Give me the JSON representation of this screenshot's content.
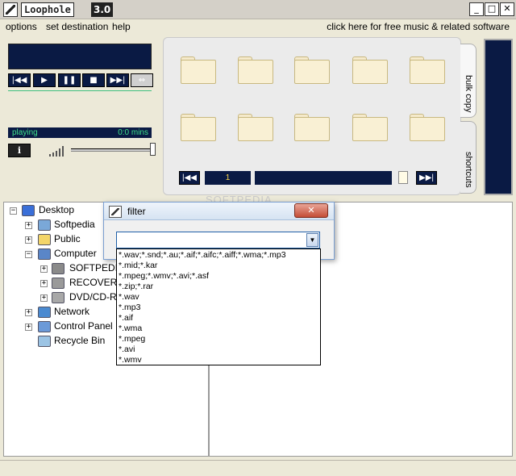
{
  "window": {
    "app_title": "Loophole",
    "app_version": "3.0",
    "minimize_glyph": "_",
    "maximize_glyph": "□",
    "close_glyph": "✕"
  },
  "menu": {
    "items": [
      "options",
      "set destination",
      "help"
    ],
    "promo_link": "click here for free music & related software"
  },
  "player": {
    "transport": {
      "first": "|◀◀",
      "play": "▶",
      "pause": "❚❚",
      "stop": "■",
      "last": "▶▶|",
      "swap": "⇔"
    },
    "status": "playing",
    "time": "0:0 mins",
    "info_label": "i",
    "volume_level": 0.95
  },
  "grid": {
    "folders": [
      {
        "row": 1,
        "col": 1
      },
      {
        "row": 1,
        "col": 2
      },
      {
        "row": 1,
        "col": 3
      },
      {
        "row": 1,
        "col": 4
      },
      {
        "row": 1,
        "col": 5
      },
      {
        "row": 2,
        "col": 1
      },
      {
        "row": 2,
        "col": 2
      },
      {
        "row": 2,
        "col": 3
      },
      {
        "row": 2,
        "col": 4
      },
      {
        "row": 2,
        "col": 5
      }
    ],
    "nav_first": "|◀◀",
    "page": "1",
    "nav_last": "▶▶|"
  },
  "tabs": {
    "bulk_copy": "bulk copy",
    "shortcuts": "shortcuts"
  },
  "tree": {
    "items": [
      {
        "label": "Desktop",
        "icon": "desktop-icon",
        "expander": "−"
      },
      {
        "label": "Softpedia",
        "icon": "user-folder-icon",
        "expander": "+"
      },
      {
        "label": "Public",
        "icon": "folder-icon",
        "expander": "+"
      },
      {
        "label": "Computer",
        "icon": "computer-icon",
        "expander": "−"
      },
      {
        "label": "SOFTPEDIA",
        "icon": "windows-drive-icon",
        "expander": "+"
      },
      {
        "label": "RECOVERY",
        "icon": "drive-icon",
        "expander": "+"
      },
      {
        "label": "DVD/CD-R",
        "icon": "dvd-drive-icon",
        "expander": "+"
      },
      {
        "label": "Network",
        "icon": "network-icon",
        "expander": "+"
      },
      {
        "label": "Control Panel",
        "icon": "control-panel-icon",
        "expander": "+"
      },
      {
        "label": "Recycle Bin",
        "icon": "recycle-bin-icon",
        "expander": ""
      }
    ]
  },
  "watermark": "SOFTPEDIA",
  "filter_dialog": {
    "title": "filter",
    "close_glyph": "✕",
    "selected_value": "",
    "dropdown_glyph": "▼",
    "options": [
      "*.wav;*.snd;*.au;*.aif;*.aifc;*.aiff;*.wma;*.mp3",
      "*.mid;*.kar",
      "*.mpeg;*.wmv;*.avi;*.asf",
      "*.zip;*.rar",
      "*.wav",
      "*.mp3",
      "*.aif",
      "*.wma",
      "*.mpeg",
      "*.avi",
      "*.wmv"
    ]
  },
  "colors": {
    "panel_navy": "#0a1a44",
    "status_green": "#3fe08a",
    "folder_beige": "#f9f0d4"
  }
}
